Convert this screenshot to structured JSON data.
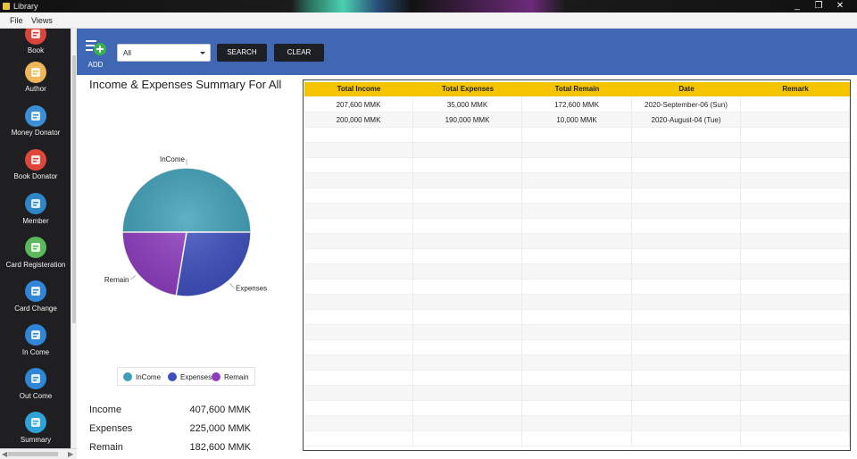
{
  "window": {
    "title": "Library",
    "controls": [
      "_",
      "❐",
      "✕"
    ]
  },
  "menu": {
    "items": [
      "File",
      "Views"
    ]
  },
  "sidebar": {
    "items": [
      {
        "label": "Book",
        "icon": "book-icon",
        "color": "#d9453b"
      },
      {
        "label": "Author",
        "icon": "author-icon",
        "color": "#f0b75a"
      },
      {
        "label": "Money Donator",
        "icon": "money-donator-icon",
        "color": "#3b8fd6"
      },
      {
        "label": "Book Donator",
        "icon": "book-donator-icon",
        "color": "#e0463a"
      },
      {
        "label": "Member",
        "icon": "member-icon",
        "color": "#2f86c8"
      },
      {
        "label": "Card Registeration",
        "icon": "card-registration-icon",
        "color": "#5cb85c"
      },
      {
        "label": "Card Change",
        "icon": "card-change-icon",
        "color": "#2f86d8"
      },
      {
        "label": "In Come",
        "icon": "income-icon",
        "color": "#2f86d8"
      },
      {
        "label": "Out Come",
        "icon": "outcome-icon",
        "color": "#2f86d8"
      },
      {
        "label": "Summary",
        "icon": "summary-icon",
        "color": "#2fa3d8"
      }
    ]
  },
  "toolbar": {
    "add_label": "ADD",
    "filter_value": "All",
    "search_label": "SEARCH",
    "clear_label": "CLEAR"
  },
  "summary": {
    "title": "Income & Expenses Summary For All",
    "chart_data": {
      "type": "pie",
      "categories": [
        "InCome",
        "Expenses",
        "Remain"
      ],
      "values": [
        407600,
        225000,
        182600
      ],
      "colors": [
        "#3f9fb8",
        "#3d4fbf",
        "#8e3cc0"
      ],
      "legend": "bottom"
    },
    "totals": [
      {
        "label": "Income",
        "value": "407,600 MMK"
      },
      {
        "label": "Expenses",
        "value": "225,000 MMK"
      },
      {
        "label": "Remain",
        "value": "182,600 MMK"
      }
    ]
  },
  "grid": {
    "columns": [
      "Total  Income",
      "Total Expenses",
      "Total Remain",
      "Date",
      "Remark"
    ],
    "rows": [
      [
        "207,600 MMK",
        "35,000 MMK",
        "172,600 MMK",
        "2020-September-06 (Sun)",
        ""
      ],
      [
        "200,000 MMK",
        "190,000 MMK",
        "10,000 MMK",
        "2020-August-04 (Tue)",
        ""
      ]
    ],
    "header_color": "#f5c400"
  }
}
